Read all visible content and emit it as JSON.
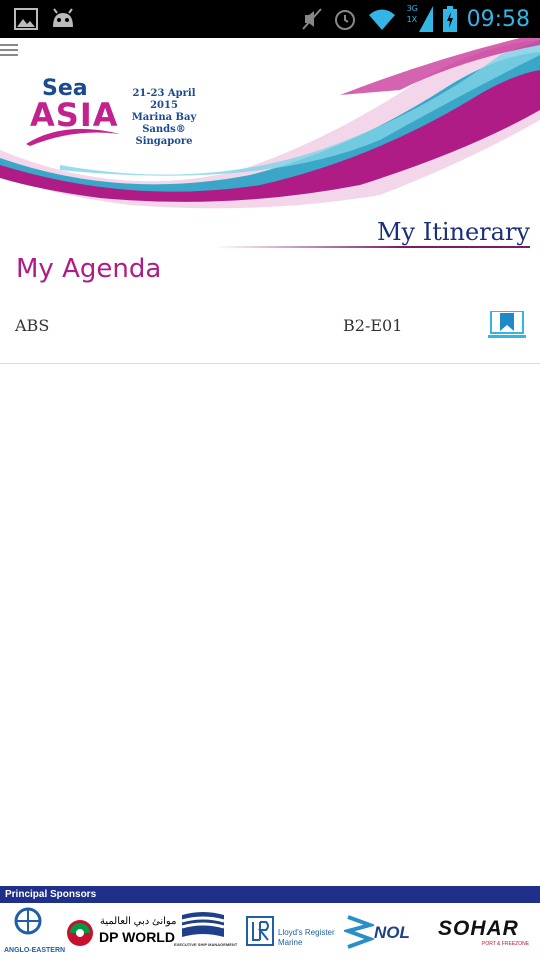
{
  "status_bar": {
    "time": "09:58",
    "network_badge_top": "3G",
    "network_badge_bottom": "1X",
    "icons": [
      "picture-icon",
      "android-icon",
      "mute-icon",
      "alarm-icon",
      "wifi-icon",
      "signal-icon",
      "battery-icon"
    ]
  },
  "header": {
    "logo_word1": "Sea",
    "logo_word2": "ASIA",
    "event_dates": "21-23 April 2015",
    "event_venue": "Marina Bay Sands®",
    "event_city": "Singapore"
  },
  "itinerary_title": "My Itinerary",
  "agenda": {
    "title": "My Agenda",
    "items": [
      {
        "name": "ABS",
        "booth": "B2-E01"
      }
    ]
  },
  "sponsors": {
    "label": "Principal Sponsors",
    "names": [
      "ANGLO-EASTERN",
      "DP WORLD",
      "موانئ دبي العالمية",
      "EXECUTIVE SHIP MANAGEMENT",
      "Lloyd's Register",
      "Marine",
      "NOL",
      "SOHAR",
      "PORT & FREEZONE"
    ]
  },
  "colors": {
    "accent_purple": "#b01c86",
    "navy": "#1a2f7a",
    "status_blue": "#33b5e5",
    "teal": "#3aa6c8"
  }
}
